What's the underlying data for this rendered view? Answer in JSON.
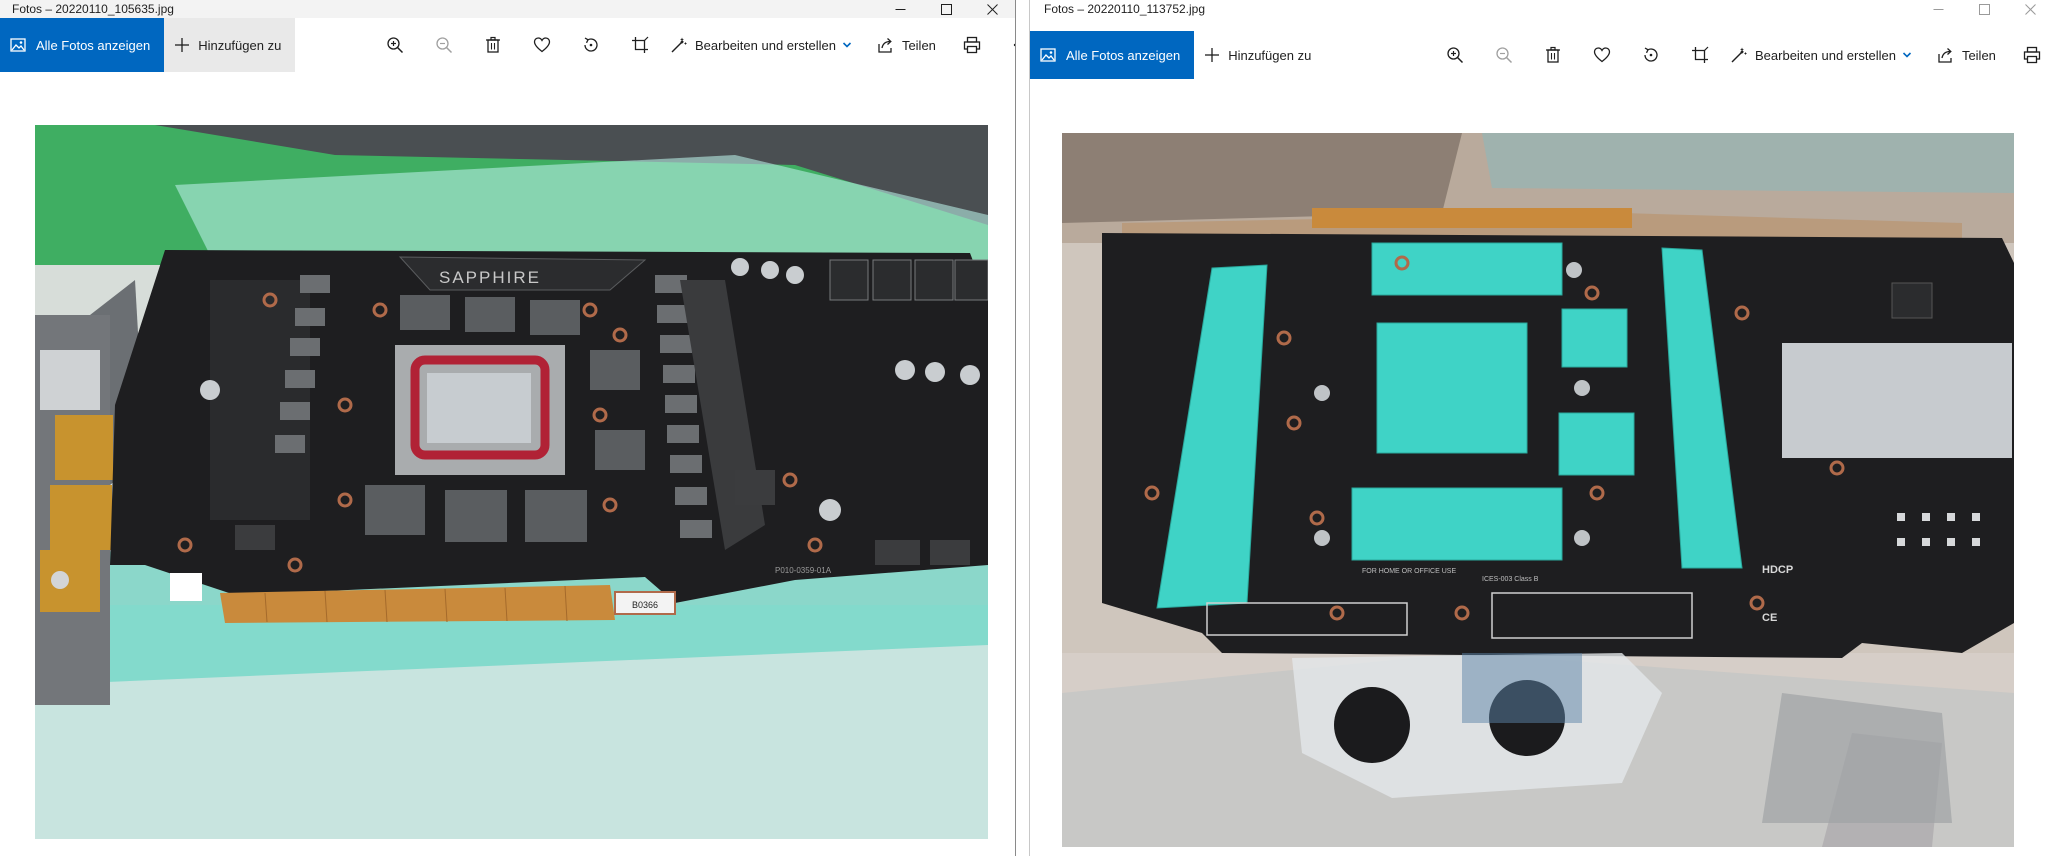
{
  "windows": [
    {
      "id": "left",
      "title": "Fotos – 20220110_105635.jpg",
      "all_photos_label": "Alle Fotos anzeigen",
      "add_label": "Hinzufügen zu",
      "edit_label": "Bearbeiten und erstellen",
      "share_label": "Teilen",
      "photo": {
        "brand_text": "SAPPHIRE",
        "sticker_text": "B0366",
        "pcb_code": "P010-0359-01A"
      }
    },
    {
      "id": "right",
      "title": "Fotos – 20220110_113752.jpg",
      "all_photos_label": "Alle Fotos anzeigen",
      "add_label": "Hinzufügen zu",
      "edit_label": "Bearbeiten und erstellen",
      "share_label": "Teilen",
      "photo": {
        "fcc_text": "FOR HOME OR OFFICE USE",
        "ices_text": "ICES-003 Class B",
        "hdcp_text": "HDCP",
        "ce_text": "CE"
      }
    }
  ],
  "colors": {
    "accent": "#0067c0",
    "thermal_pad": "#3fd3c6",
    "pcb": "#1e1e20",
    "gold_fingers": "#c98a3c"
  },
  "icons": {
    "zoom_in": "zoom-in-icon",
    "zoom_out": "zoom-out-icon",
    "delete": "trash-icon",
    "favorite": "heart-icon",
    "rotate": "rotate-icon",
    "crop": "crop-icon",
    "edit": "edit-create-icon",
    "share": "share-icon",
    "print": "print-icon",
    "more": "more-icon"
  }
}
